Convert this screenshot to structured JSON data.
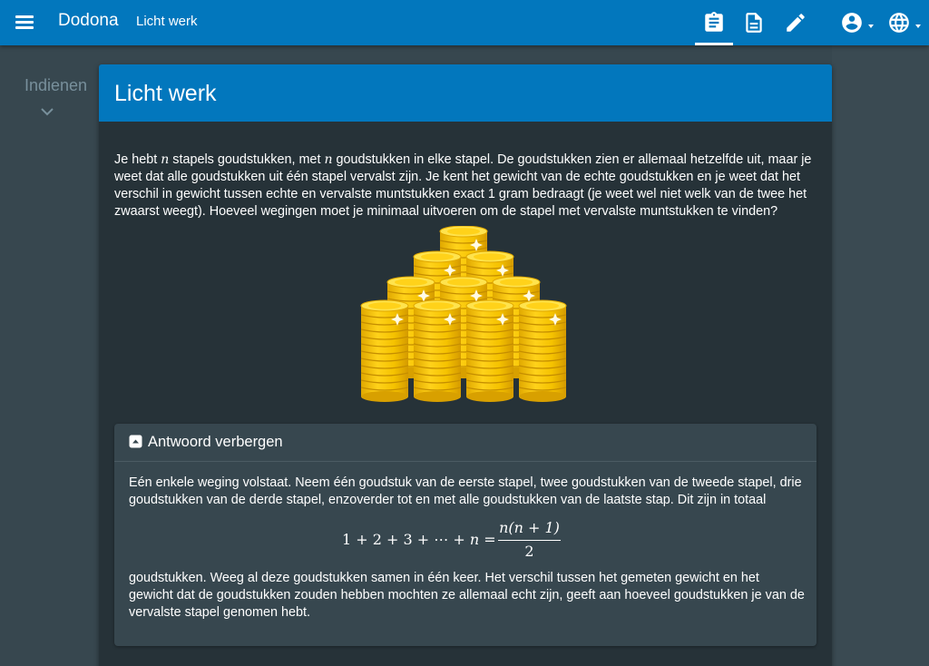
{
  "appbar": {
    "brand": "Dodona",
    "breadcrumb": "Licht werk",
    "icons": [
      "menu-icon",
      "clipboard-icon",
      "document-icon",
      "pencil-icon",
      "account-icon",
      "globe-icon"
    ],
    "color": "#0277bd"
  },
  "sidebar": {
    "label": "Indienen"
  },
  "exercise": {
    "title": "Licht werk",
    "description": {
      "p1": "Je hebt ",
      "var1": "n",
      "p2": " stapels goudstukken, met ",
      "var2": "n",
      "p3": " goudstukken in elke stapel. De goudstukken zien er allemaal hetzelfde uit, maar je weet dat alle goudstukken uit één stapel vervalst zijn. Je kent het gewicht van de echte goudstukken en je weet dat het verschil in gewicht tussen echte en vervalste muntstukken exact 1 gram bedraagt (je weet wel niet welk van de twee het zwaarst weegt). Hoeveel wegingen moet je minimaal uitvoeren om de stapel met vervalste muntstukken te vinden?"
    },
    "image": "gold-coin-stacks"
  },
  "answer": {
    "toggle_label": "Antwoord verbergen",
    "text_before": "Eén enkele weging volstaat. Neem één goudstuk van de eerste stapel, twee goudstukken van de tweede stapel, drie goudstukken van de derde stapel, enzoverder tot en met alle goudstukken van de laatste stap. Dit zijn in totaal",
    "formula": {
      "lhs": "1 + 2 + 3 + ⋯ + n =",
      "numerator": "n(n + 1)",
      "denominator": "2"
    },
    "text_after": "goudstukken. Weeg al deze goudstukken samen in één keer. Het verschil tussen het gemeten gewicht en het gewicht dat de goudstukken zouden hebben mochten ze allemaal echt zijn, geeft aan hoeveel goudstukken je van de vervalste stapel genomen hebt."
  }
}
